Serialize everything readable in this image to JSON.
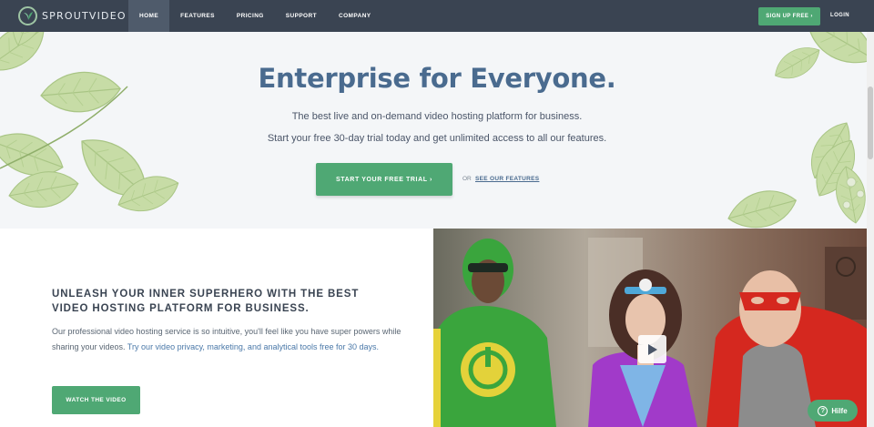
{
  "nav": {
    "logo_text": "SPROUTVIDEO",
    "items": [
      {
        "label": "HOME"
      },
      {
        "label": "FEATURES"
      },
      {
        "label": "PRICING"
      },
      {
        "label": "SUPPORT"
      },
      {
        "label": "COMPANY"
      }
    ],
    "signup_label": "SIGN UP FREE ›",
    "login_label": "LOGIN"
  },
  "hero": {
    "title": "Enterprise for Everyone.",
    "subtitle_1": "The best live and on-demand video hosting platform for business.",
    "subtitle_2": "Start your free 30-day trial today and get unlimited access to all our features.",
    "trial_button": "START YOUR FREE TRIAL ›",
    "or_text": "OR",
    "features_link": "SEE OUR FEATURES"
  },
  "lower": {
    "title": "UNLEASH YOUR INNER SUPERHERO WITH THE BEST VIDEO HOSTING PLATFORM FOR BUSINESS.",
    "body_plain": "Our professional video hosting service is so intuitive, you'll feel like you have super powers while sharing your videos. ",
    "body_link": "Try our video privacy, marketing, and analytical tools free for 30 days.",
    "watch_button": "WATCH THE VIDEO"
  },
  "help": {
    "label": "Hilfe",
    "icon_glyph": "?"
  },
  "colors": {
    "nav_bg": "#3a4452",
    "accent_green": "#4fa874",
    "title_blue": "#4a6b8f"
  }
}
